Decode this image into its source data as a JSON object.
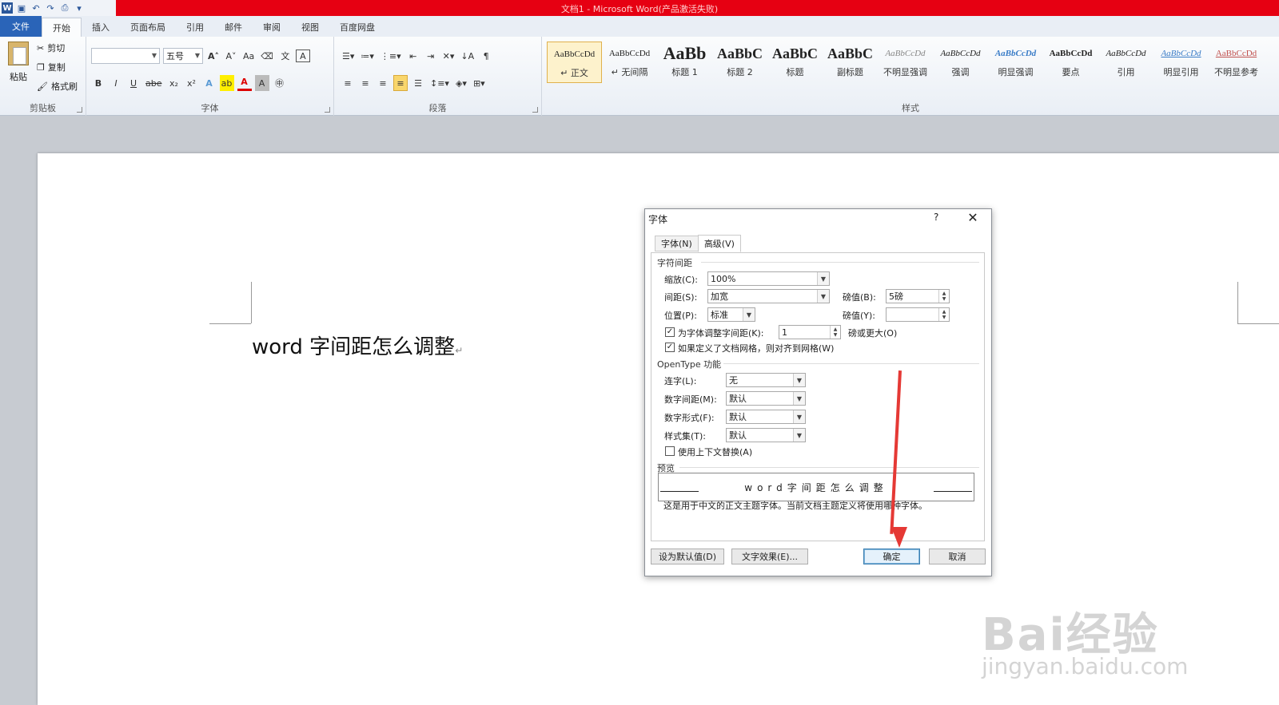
{
  "window": {
    "title": "文档1 - Microsoft Word(产品激活失败)"
  },
  "tabs": [
    {
      "label": "文件"
    },
    {
      "label": "开始"
    },
    {
      "label": "插入"
    },
    {
      "label": "页面布局"
    },
    {
      "label": "引用"
    },
    {
      "label": "邮件"
    },
    {
      "label": "审阅"
    },
    {
      "label": "视图"
    },
    {
      "label": "百度网盘"
    }
  ],
  "ribbon": {
    "clipboard": {
      "paste": "粘贴",
      "cut": "剪切",
      "copy": "复制",
      "format_painter": "格式刷",
      "group": "剪贴板"
    },
    "font": {
      "font_name": "",
      "font_size": "五号",
      "group": "字体",
      "grow": "A",
      "shrink": "A",
      "change_case": "Aa",
      "bold": "B",
      "italic": "I",
      "underline": "U",
      "strike": "abe",
      "subscript": "x₂",
      "superscript": "x²"
    },
    "paragraph": {
      "group": "段落"
    },
    "styles": {
      "group": "样式",
      "items": [
        {
          "preview": "AaBbCcDd",
          "name": "↵ 正文"
        },
        {
          "preview": "AaBbCcDd",
          "name": "↵ 无间隔"
        },
        {
          "preview": "AaBb",
          "name": "标题 1"
        },
        {
          "preview": "AaBbC",
          "name": "标题 2"
        },
        {
          "preview": "AaBbC",
          "name": "标题"
        },
        {
          "preview": "AaBbC",
          "name": "副标题"
        },
        {
          "preview": "AaBbCcDd",
          "name": "不明显强调"
        },
        {
          "preview": "AaBbCcDd",
          "name": "强调"
        },
        {
          "preview": "AaBbCcDd",
          "name": "明显强调"
        },
        {
          "preview": "AaBbCcDd",
          "name": "要点"
        },
        {
          "preview": "AaBbCcDd",
          "name": "引用"
        },
        {
          "preview": "AaBbCcDd",
          "name": "明显引用"
        },
        {
          "preview": "AaBbCcDd",
          "name": "不明显参考"
        }
      ]
    }
  },
  "document": {
    "text": "word 字间距怎么调整",
    "para_mark": "↵"
  },
  "dialog": {
    "title": "字体",
    "help": "?",
    "close": "✕",
    "tabs": [
      {
        "label": "字体(N)"
      },
      {
        "label": "高级(V)"
      }
    ],
    "spacing_section": "字符间距",
    "scale_label": "缩放(C):",
    "scale_value": "100%",
    "spacing_label": "间距(S):",
    "spacing_value": "加宽",
    "spacing_by_label": "磅值(B):",
    "spacing_by_value": "5磅",
    "position_label": "位置(P):",
    "position_value": "标准",
    "position_by_label": "磅值(Y):",
    "position_by_value": "",
    "kerning_label": "为字体调整字间距(K):",
    "kerning_value": "1",
    "kerning_suffix": "磅或更大(O)",
    "grid_label": "如果定义了文档网格，则对齐到网格(W)",
    "opentype_section": "OpenType 功能",
    "ligatures_label": "连字(L):",
    "ligatures_value": "无",
    "num_spacing_label": "数字间距(M):",
    "num_spacing_value": "默认",
    "num_forms_label": "数字形式(F):",
    "num_forms_value": "默认",
    "stylistic_label": "样式集(T):",
    "stylistic_value": "默认",
    "contextual_label": "使用上下文替换(A)",
    "preview_section": "预览",
    "preview_text": "word字间距怎么调整",
    "preview_note": "这是用于中文的正文主题字体。当前文档主题定义将使用哪种字体。",
    "set_default": "设为默认值(D)",
    "text_effects": "文字效果(E)...",
    "ok": "确定",
    "cancel": "取消"
  },
  "watermark": {
    "logo": "Bai经验",
    "url": "jingyan.baidu.com"
  }
}
